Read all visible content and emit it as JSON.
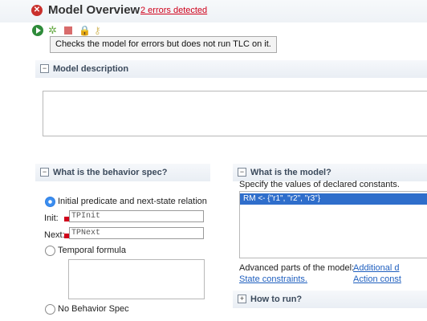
{
  "header": {
    "title": "Model Overview",
    "error_link": "2 errors detected",
    "error_icon": "error-icon"
  },
  "toolbar": {
    "icons": [
      "run-icon",
      "check-icon",
      "stop-icon",
      "lock-icon",
      "key-icon"
    ]
  },
  "tooltip": {
    "text": "Checks the model for errors but does not run TLC on it."
  },
  "sections": {
    "model_description": {
      "title": "Model description"
    },
    "behavior": {
      "title": "What is the behavior spec?",
      "option_init": "Initial predicate and next-state relation",
      "init_label": "Init:",
      "init_value": "TPInit",
      "next_label": "Next:",
      "next_value": "TPNext",
      "option_temporal": "Temporal formula",
      "option_none": "No Behavior Spec",
      "selected": "init-next"
    },
    "model": {
      "title": "What is the model?",
      "subtitle": "Specify the values of declared constants.",
      "constants": [
        "RM <- {\"r1\", \"r2\", \"r3\"}"
      ],
      "advanced_label": "Advanced parts of the model:",
      "advanced_link": "Additional d",
      "state_constraints": "State constraints.",
      "action_constraints": "Action const"
    },
    "run": {
      "title": "How to run?"
    }
  },
  "colors": {
    "error": "#d0021b",
    "link": "#1f5fbf",
    "selection": "#2f6ecb"
  }
}
